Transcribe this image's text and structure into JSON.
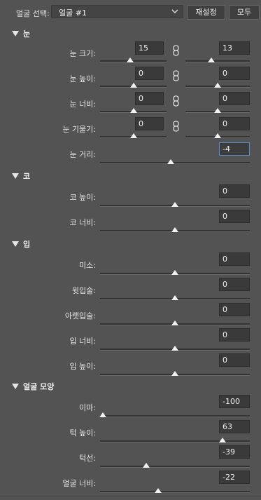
{
  "header": {
    "label": "얼굴 선택:",
    "selected_face": "얼굴 #1",
    "reset_label": "재설정",
    "all_label": "모두"
  },
  "sections": {
    "eyes": "눈",
    "nose": "코",
    "mouth": "입",
    "face_shape": "얼굴 모양"
  },
  "eyes": {
    "size": {
      "label": "눈 크기:",
      "left": "15",
      "right": "13",
      "left_level": 0.45,
      "right_level": 0.4
    },
    "height": {
      "label": "눈 높이:",
      "left": "0",
      "right": "0",
      "left_level": 0.5,
      "right_level": 0.5
    },
    "width": {
      "label": "눈 너비:",
      "left": "0",
      "right": "0",
      "left_level": 0.5,
      "right_level": 0.5
    },
    "tilt": {
      "label": "눈 기울기:",
      "left": "0",
      "right": "0",
      "left_level": 0.5,
      "right_level": 0.5
    },
    "distance": {
      "label": "눈 거리:",
      "value": "-4",
      "level": 0.47
    }
  },
  "nose": {
    "height": {
      "label": "코 높이:",
      "value": "0",
      "level": 0.5
    },
    "width": {
      "label": "코 너비:",
      "value": "0",
      "level": 0.5
    }
  },
  "mouth": {
    "smile": {
      "label": "미소:",
      "value": "0",
      "level": 0.5
    },
    "upper_lip": {
      "label": "윗입술:",
      "value": "0",
      "level": 0.5
    },
    "lower_lip": {
      "label": "아랫입술:",
      "value": "0",
      "level": 0.5
    },
    "width": {
      "label": "입 너비:",
      "value": "0",
      "level": 0.5
    },
    "height": {
      "label": "입 높이:",
      "value": "0",
      "level": 0.5
    }
  },
  "face_shape": {
    "forehead": {
      "label": "이마:",
      "value": "-100",
      "level": 0.02
    },
    "chin_height": {
      "label": "턱 높이:",
      "value": "63",
      "level": 0.82
    },
    "jawline": {
      "label": "턱선:",
      "value": "-39",
      "level": 0.31
    },
    "face_width": {
      "label": "얼굴 너비:",
      "value": "-22",
      "level": 0.39
    }
  },
  "colors": {
    "panel_bg": "#535353",
    "field_bg": "#3a3a3a",
    "focus_border": "#4f8edb",
    "knob": "#f2f2f2"
  }
}
